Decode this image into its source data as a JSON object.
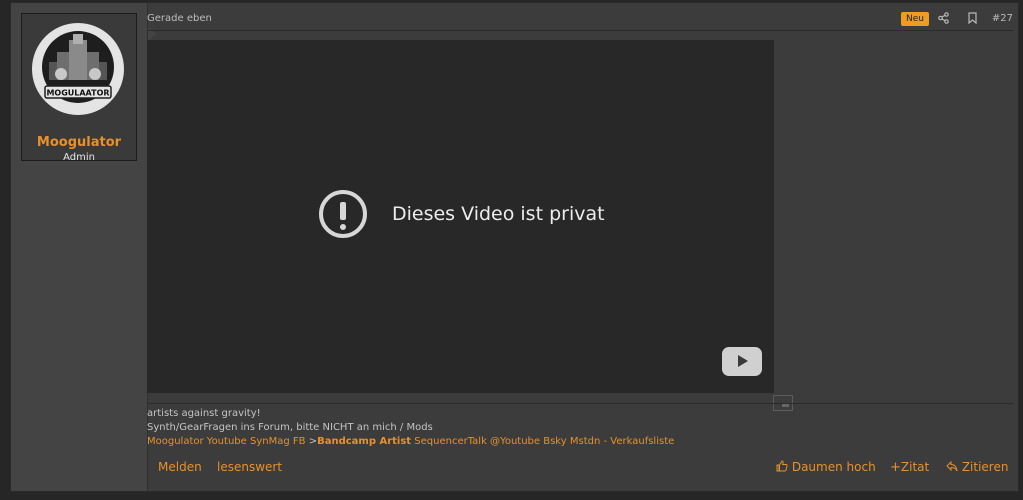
{
  "post": {
    "date": "Gerade eben",
    "badge": "Neu",
    "post_number": "#27"
  },
  "user": {
    "name": "Moogulator",
    "title": "Admin",
    "avatar_text": "MOGULAATOR"
  },
  "video": {
    "message": "Dieses Video ist privat"
  },
  "signature": {
    "line1": "artists against gravity!",
    "line2": "Synth/GearFragen ins Forum, bitte NICHT an mich / Mods",
    "links": [
      "Moogulator Youtube",
      "SynMag",
      "FB",
      "Bandcamp Artist",
      "SequencerTalk",
      "@Youtube",
      "Bsky",
      "Mstdn",
      "Verkaufsliste"
    ],
    "sep_gt": ">",
    "sep_dash": "-"
  },
  "actions": {
    "report": "Melden",
    "bookmark_worthy": "lesenswert",
    "like": "Daumen hoch",
    "quote": "Zitat",
    "reply": "Zitieren"
  },
  "icons": {
    "share": "share-icon",
    "bookmark": "bookmark-icon",
    "warning": "exclamation-icon",
    "play": "youtube-play-icon",
    "thumbs_up": "thumbs-up-icon",
    "plus": "plus-icon",
    "reply": "reply-icon"
  },
  "colors": {
    "accent": "#e8912a",
    "badge": "#f19c1f",
    "background": "#3c3c3c"
  }
}
